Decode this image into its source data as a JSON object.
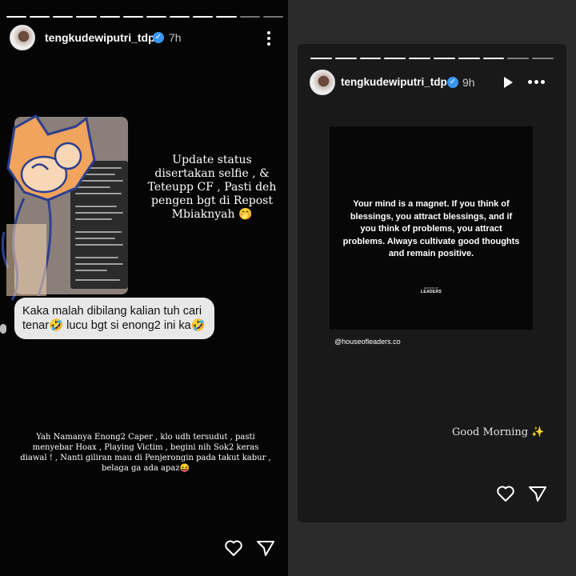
{
  "left_story": {
    "progress_segments_total": 12,
    "progress_segments_done": 10,
    "username": "tengkudewiputri_tdp",
    "time": "7h",
    "update_text": "Update status disertakan selfie , & Teteupp CF , Pasti deh pengen bgt di Repost Mbiaknyah 🤭",
    "comment_text": "Kaka malah dibilang kalian tuh cari tenar🤣 lucu bgt si enong2 ini ka🤣",
    "caption": "Yah Namanya Enong2 Caper , klo udh tersudut , pasti menyebar Hoax , Playing Victim , begini nih Sok2 keras diawal ! , Nanti giliran mau di Penjerongin pada takut kabur , belaga ga ada apaz😝",
    "icons": [
      "profile-avatar",
      "verified-badge-icon",
      "more-options-icon",
      "heart-icon",
      "send-icon"
    ]
  },
  "right_story": {
    "progress_segments_total": 10,
    "progress_segments_done": 8,
    "username": "tengkudewiputri_tdp",
    "time": "9h",
    "quote": "Your mind is a magnet. If you think of blessings, you attract blessings, and if you think of problems, you attract problems. Always cultivate good thoughts and remain positive.",
    "quote_logo": "LEADERS",
    "handle": "@houseofleaders.co",
    "greeting": "Good Morning ✨",
    "icons": [
      "profile-avatar",
      "verified-badge-icon",
      "play-icon",
      "more-options-icon",
      "heart-icon",
      "send-icon"
    ]
  },
  "colors": {
    "left_bg": "#050505",
    "right_bg": "#2a2a2a",
    "story_bg": "#191919",
    "verified": "#3897f0",
    "bubble": "#e8e8e8"
  }
}
